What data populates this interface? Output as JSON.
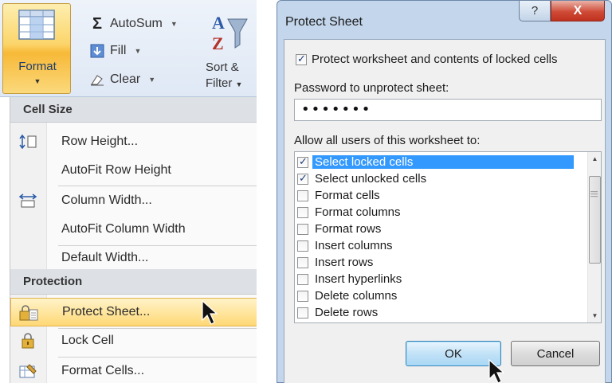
{
  "ribbon": {
    "format_label": "Format",
    "autosum_label": "AutoSum",
    "fill_label": "Fill",
    "clear_label": "Clear",
    "sort_filter_line1": "Sort &",
    "sort_filter_line2": "Filter"
  },
  "format_menu": {
    "cell_size_header": "Cell Size",
    "row_height": "Row Height...",
    "autofit_row_height": "AutoFit Row Height",
    "column_width": "Column Width...",
    "autofit_column_width": "AutoFit Column Width",
    "default_width": "Default Width...",
    "protection_header": "Protection",
    "protect_sheet": "Protect Sheet...",
    "lock_cell": "Lock Cell",
    "format_cells": "Format Cells..."
  },
  "dialog": {
    "title": "Protect Sheet",
    "help_symbol": "?",
    "close_symbol": "X",
    "protect_contents_label": "Protect worksheet and contents of locked cells",
    "protect_contents_checked": true,
    "password_label": "Password to unprotect sheet:",
    "password_value": "•••••••",
    "allow_label": "Allow all users of this worksheet to:",
    "permissions": [
      {
        "label": "Select locked cells",
        "checked": true,
        "selected": true
      },
      {
        "label": "Select unlocked cells",
        "checked": true,
        "selected": false
      },
      {
        "label": "Format cells",
        "checked": false,
        "selected": false
      },
      {
        "label": "Format columns",
        "checked": false,
        "selected": false
      },
      {
        "label": "Format rows",
        "checked": false,
        "selected": false
      },
      {
        "label": "Insert columns",
        "checked": false,
        "selected": false
      },
      {
        "label": "Insert rows",
        "checked": false,
        "selected": false
      },
      {
        "label": "Insert hyperlinks",
        "checked": false,
        "selected": false
      },
      {
        "label": "Delete columns",
        "checked": false,
        "selected": false
      },
      {
        "label": "Delete rows",
        "checked": false,
        "selected": false
      }
    ],
    "ok_label": "OK",
    "cancel_label": "Cancel"
  },
  "colors": {
    "selection": "#3399ff",
    "highlight": "#ffd875",
    "close_red": "#c0311e"
  }
}
